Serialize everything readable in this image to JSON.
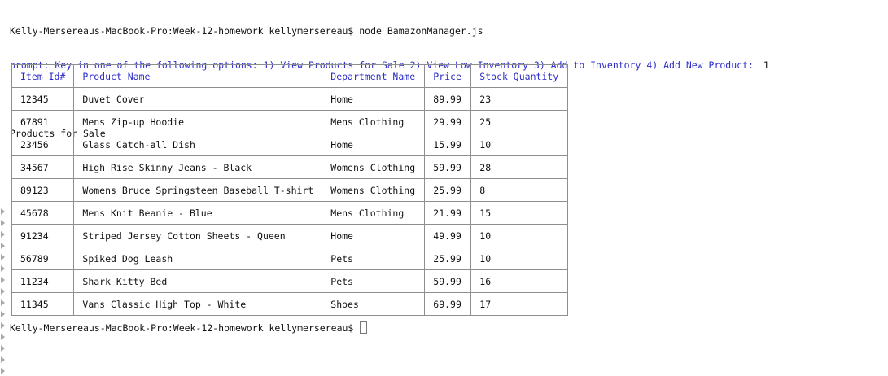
{
  "terminal": {
    "command_line": "Kelly-Mersereaus-MacBook-Pro:Week-12-homework kellymersereau$ node BamazonManager.js",
    "prompt_text": "prompt: Key in one of the following options: 1) View Products for Sale 2) View Low Inventory 3) Add to Inventory 4) Add New Product:",
    "prompt_answer": "1",
    "section_title": "Products for Sale",
    "final_prompt": "Kelly-Mersereaus-MacBook-Pro:Week-12-homework kellymersereau$"
  },
  "table": {
    "headers": [
      "Item Id#",
      "Product Name",
      "Department Name",
      "Price",
      "Stock Quantity"
    ],
    "rows": [
      [
        "12345",
        "Duvet Cover",
        "Home",
        "89.99",
        "23"
      ],
      [
        "67891",
        "Mens Zip-up Hoodie",
        "Mens Clothing",
        "29.99",
        "25"
      ],
      [
        "23456",
        "Glass Catch-all Dish",
        "Home",
        "15.99",
        "10"
      ],
      [
        "34567",
        "High Rise Skinny Jeans - Black",
        "Womens Clothing",
        "59.99",
        "28"
      ],
      [
        "89123",
        "Womens Bruce Springsteen Baseball T-shirt",
        "Womens Clothing",
        "25.99",
        "8"
      ],
      [
        "45678",
        "Mens Knit Beanie - Blue",
        "Mens Clothing",
        "21.99",
        "15"
      ],
      [
        "91234",
        "Striped Jersey Cotton Sheets - Queen",
        "Home",
        "49.99",
        "10"
      ],
      [
        "56789",
        "Spiked Dog Leash",
        "Pets",
        "25.99",
        "10"
      ],
      [
        "11234",
        "Shark Kitty Bed",
        "Pets",
        "59.99",
        "16"
      ],
      [
        "11345",
        "Vans Classic High Top - White",
        "Shoes",
        "69.99",
        "17"
      ]
    ]
  },
  "colors": {
    "prompt_blue": "#2c2cc9",
    "text": "#111111",
    "table_border": "#8e8e8e",
    "gutter_marker": "#a9a9a9"
  }
}
